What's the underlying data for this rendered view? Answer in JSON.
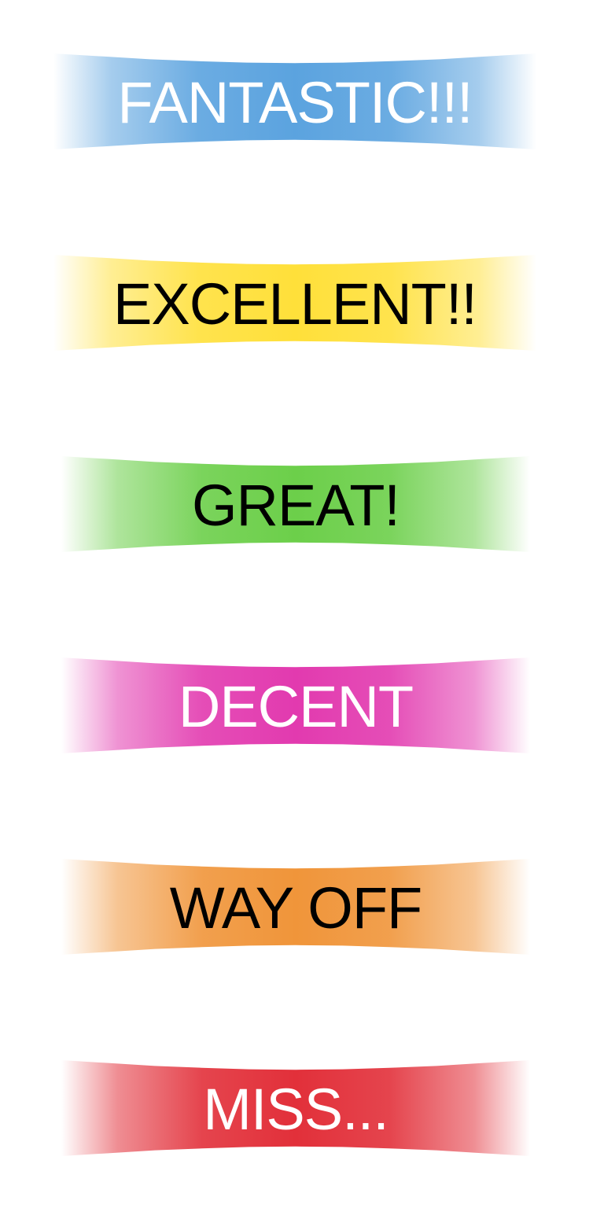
{
  "judgement_banners": [
    {
      "label": "FANTASTIC!!!",
      "color": "#5ba3df",
      "text_color": "#ffffff"
    },
    {
      "label": "EXCELLENT!!",
      "color": "#ffe03a",
      "text_color": "#000000"
    },
    {
      "label": "GREAT!",
      "color": "#6ccf4a",
      "text_color": "#000000"
    },
    {
      "label": "DECENT",
      "color": "#e23aaf",
      "text_color": "#ffffff"
    },
    {
      "label": "WAY OFF",
      "color": "#f0953a",
      "text_color": "#000000"
    },
    {
      "label": "MISS...",
      "color": "#e2303a",
      "text_color": "#ffffff"
    }
  ]
}
